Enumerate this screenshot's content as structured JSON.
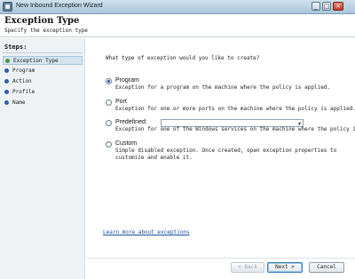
{
  "window": {
    "title": "New Inbound Exception Wizard",
    "controls": {
      "minimize": "_",
      "maximize": "□",
      "close": "×"
    }
  },
  "header": {
    "title": "Exception Type",
    "subtitle": "Specify the exception type"
  },
  "steps": {
    "heading": "Steps:",
    "items": [
      {
        "label": "Exception Type",
        "status": "current"
      },
      {
        "label": "Program",
        "status": "pending"
      },
      {
        "label": "Action",
        "status": "pending"
      },
      {
        "label": "Profile",
        "status": "pending"
      },
      {
        "label": "Name",
        "status": "pending"
      }
    ],
    "colors": {
      "current_dot": "#4a9a3a",
      "pending_dot": "#2f5ea8"
    }
  },
  "main": {
    "question": "What type of exception would you like to create?",
    "options": [
      {
        "label": "Program",
        "description": "Exception for a program on the machine where the policy is applied.",
        "checked": true
      },
      {
        "label": "Port",
        "description": "Exception for one or more ports on the machine where the policy is applied.",
        "checked": false
      },
      {
        "label": "Predefined:",
        "description": "Exception for one of the Windows services on the machine where the policy is",
        "checked": false,
        "select_value": ""
      },
      {
        "label": "Custom",
        "description_line1": "Simple disabled exception. Once created, open exception properties to",
        "description_line2": "customize and enable it.",
        "checked": false
      }
    ],
    "learn_link": "Learn more about exceptions"
  },
  "buttons": {
    "back": "< Back",
    "next": "Next >",
    "cancel": "Cancel"
  }
}
